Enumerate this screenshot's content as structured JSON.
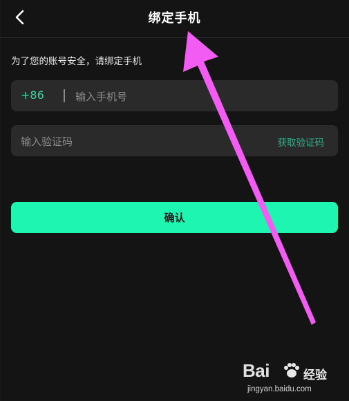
{
  "header": {
    "title": "绑定手机",
    "back_icon": "chevron-left-icon"
  },
  "notice": "为了您的账号安全，请绑定手机",
  "phone_field": {
    "country_code": "+86",
    "placeholder": "输入手机号"
  },
  "code_field": {
    "placeholder": "输入验证码",
    "get_code_label": "获取验证码"
  },
  "confirm": {
    "label": "确认"
  },
  "annotation": {
    "color": "#f35cf3",
    "icon": "annotation-arrow"
  },
  "watermark": {
    "brand_prefix": "Bai",
    "brand_icon": "paw-icon",
    "brand_suffix": "经验",
    "url": "jingyan.baidu.com"
  },
  "colors": {
    "background": "#141414",
    "accent": "#1df5b0",
    "accent_text": "#2fb38a",
    "field_bg": "#2a2a2a"
  }
}
